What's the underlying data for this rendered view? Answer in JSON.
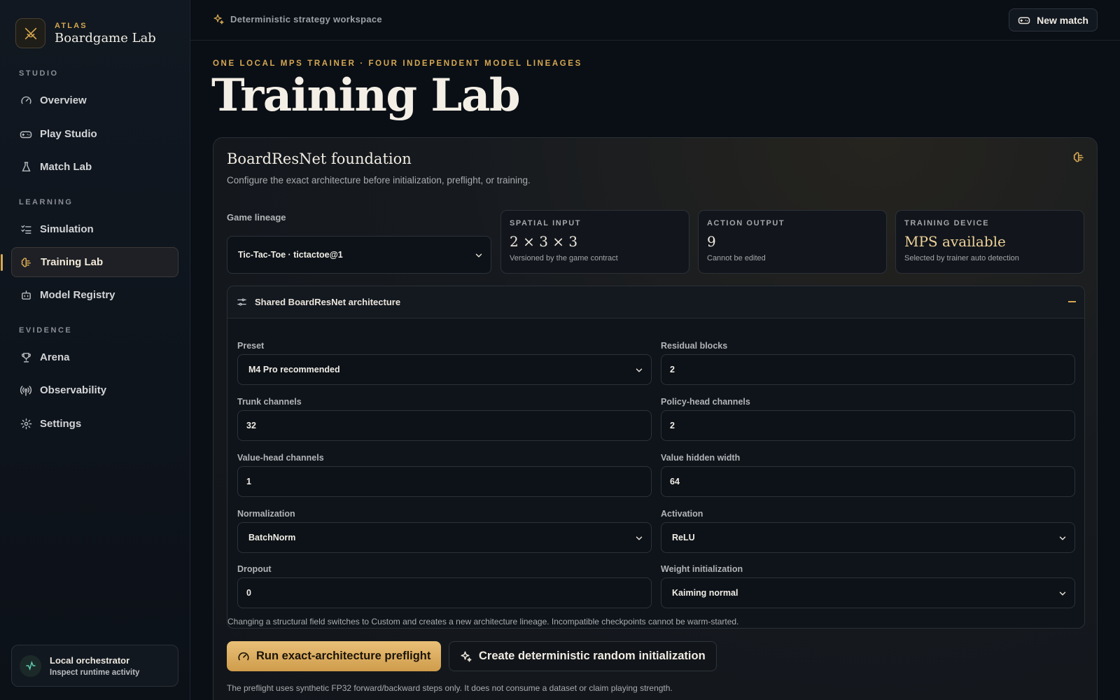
{
  "brand": {
    "eyebrow": "ATLAS",
    "name": "Boardgame Lab"
  },
  "nav": {
    "sections": {
      "studio": "STUDIO",
      "learning": "LEARNING",
      "evidence": "EVIDENCE"
    },
    "items": [
      {
        "label": "Overview",
        "icon": "gauge-icon"
      },
      {
        "label": "Play Studio",
        "icon": "gamepad-icon"
      },
      {
        "label": "Match Lab",
        "icon": "flask-icon"
      },
      {
        "label": "Simulation",
        "icon": "list-check-icon"
      },
      {
        "label": "Training Lab",
        "icon": "brain-icon",
        "active": true
      },
      {
        "label": "Model Registry",
        "icon": "bot-icon"
      },
      {
        "label": "Arena",
        "icon": "trophy-icon"
      },
      {
        "label": "Observability",
        "icon": "radio-icon"
      },
      {
        "label": "Settings",
        "icon": "gear-icon"
      }
    ]
  },
  "orchestrator": {
    "title": "Local orchestrator",
    "subtitle": "Inspect runtime activity"
  },
  "topbar": {
    "breadcrumb": "Deterministic strategy workspace",
    "new_match": "New match"
  },
  "header": {
    "eyebrow": "ONE LOCAL MPS TRAINER · FOUR INDEPENDENT MODEL LINEAGES",
    "title": "Training Lab"
  },
  "card": {
    "title": "BoardResNet foundation",
    "description": "Configure the exact architecture before initialization, preflight, or training.",
    "lineage_label": "Game lineage",
    "lineage_value": "Tic-Tac-Toe · tictactoe@1",
    "stats": [
      {
        "label": "SPATIAL INPUT",
        "value": "2 × 3 × 3",
        "note": "Versioned by the game contract"
      },
      {
        "label": "ACTION OUTPUT",
        "value": "9",
        "note": "Cannot be edited"
      },
      {
        "label": "TRAINING DEVICE",
        "value": "MPS available",
        "note": "Selected by trainer auto detection"
      }
    ]
  },
  "architecture": {
    "title": "Shared BoardResNet architecture",
    "fields": {
      "preset": {
        "label": "Preset",
        "value": "M4 Pro recommended"
      },
      "residual_blocks": {
        "label": "Residual blocks",
        "value": "2"
      },
      "trunk_channels": {
        "label": "Trunk channels",
        "value": "32"
      },
      "policy_head_channels": {
        "label": "Policy-head channels",
        "value": "2"
      },
      "value_head_channels": {
        "label": "Value-head channels",
        "value": "1"
      },
      "value_hidden_width": {
        "label": "Value hidden width",
        "value": "64"
      },
      "normalization": {
        "label": "Normalization",
        "value": "BatchNorm"
      },
      "activation": {
        "label": "Activation",
        "value": "ReLU"
      },
      "dropout": {
        "label": "Dropout",
        "value": "0"
      },
      "weight_init": {
        "label": "Weight initialization",
        "value": "Kaiming normal"
      }
    },
    "note": "Changing a structural field switches to Custom and creates a new architecture lineage. Incompatible checkpoints cannot be warm-started."
  },
  "actions": {
    "preflight": "Run exact-architecture preflight",
    "random_init": "Create deterministic random initialization",
    "note": "The preflight uses synthetic FP32 forward/backward steps only. It does not consume a dataset or claim playing strength."
  },
  "colors": {
    "accent": "#d6a851",
    "background": "#0a0f16",
    "panel": "#12161c"
  }
}
